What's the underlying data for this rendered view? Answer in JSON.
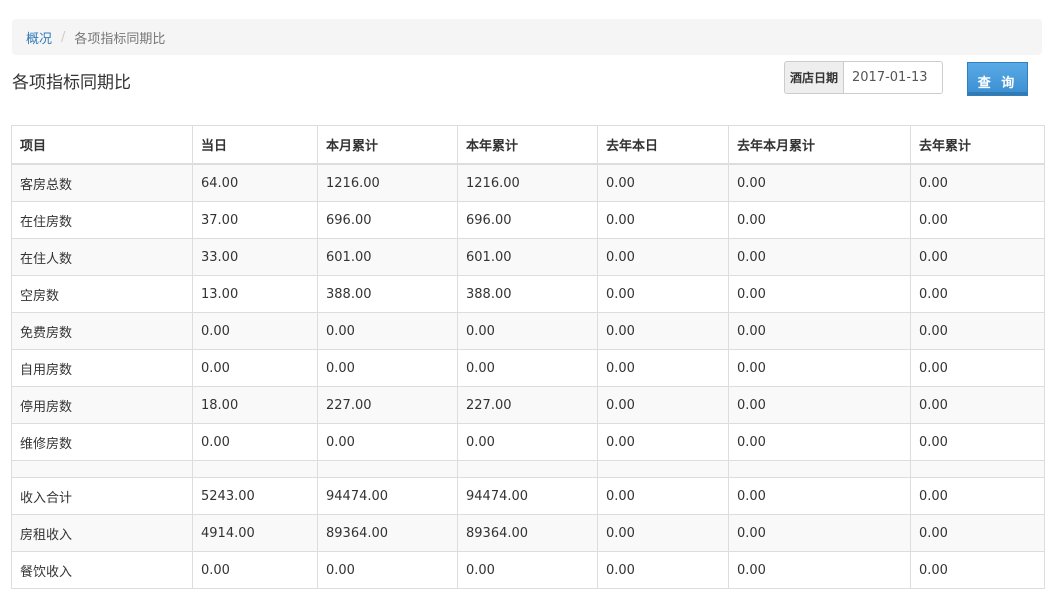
{
  "breadcrumb": {
    "home": "概况",
    "separator": "/",
    "current": "各项指标同期比"
  },
  "page_title": "各项指标同期比",
  "date_filter": {
    "label": "酒店日期",
    "value": "2017-01-13"
  },
  "query_button": "查 询",
  "table": {
    "headers": [
      "项目",
      "当日",
      "本月累计",
      "本年累计",
      "去年本日",
      "去年本月累计",
      "去年累计"
    ],
    "rows": [
      [
        "客房总数",
        "64.00",
        "1216.00",
        "1216.00",
        "0.00",
        "0.00",
        "0.00"
      ],
      [
        "在住房数",
        "37.00",
        "696.00",
        "696.00",
        "0.00",
        "0.00",
        "0.00"
      ],
      [
        "在住人数",
        "33.00",
        "601.00",
        "601.00",
        "0.00",
        "0.00",
        "0.00"
      ],
      [
        "空房数",
        "13.00",
        "388.00",
        "388.00",
        "0.00",
        "0.00",
        "0.00"
      ],
      [
        "免费房数",
        "0.00",
        "0.00",
        "0.00",
        "0.00",
        "0.00",
        "0.00"
      ],
      [
        "自用房数",
        "0.00",
        "0.00",
        "0.00",
        "0.00",
        "0.00",
        "0.00"
      ],
      [
        "停用房数",
        "18.00",
        "227.00",
        "227.00",
        "0.00",
        "0.00",
        "0.00"
      ],
      [
        "维修房数",
        "0.00",
        "0.00",
        "0.00",
        "0.00",
        "0.00",
        "0.00"
      ],
      [
        "",
        "",
        "",
        "",
        "",
        "",
        ""
      ],
      [
        "收入合计",
        "5243.00",
        "94474.00",
        "94474.00",
        "0.00",
        "0.00",
        "0.00"
      ],
      [
        "房租收入",
        "4914.00",
        "89364.00",
        "89364.00",
        "0.00",
        "0.00",
        "0.00"
      ],
      [
        "餐饮收入",
        "0.00",
        "0.00",
        "0.00",
        "0.00",
        "0.00",
        "0.00"
      ]
    ]
  }
}
